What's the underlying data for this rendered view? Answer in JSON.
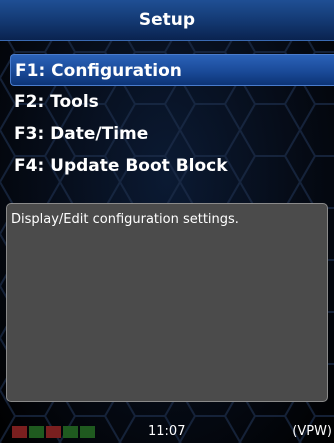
{
  "title": "Setup",
  "menu": [
    {
      "label": "F1: Configuration",
      "selected": true
    },
    {
      "label": "F2: Tools",
      "selected": false
    },
    {
      "label": "F3: Date/Time",
      "selected": false
    },
    {
      "label": "F4: Update Boot Block",
      "selected": false
    }
  ],
  "description": "Display/Edit configuration settings.",
  "status": {
    "time": "11:07",
    "mode": "(VPW)",
    "indicator_colors": [
      "#7a1f1f",
      "#1f5a1f",
      "#7a1f1f",
      "#1f5a1f",
      "#1f5a1f"
    ]
  },
  "colors": {
    "title_bar": "#143a74",
    "selection": "#1a4a98",
    "description_bg": "#4b4b4b"
  }
}
